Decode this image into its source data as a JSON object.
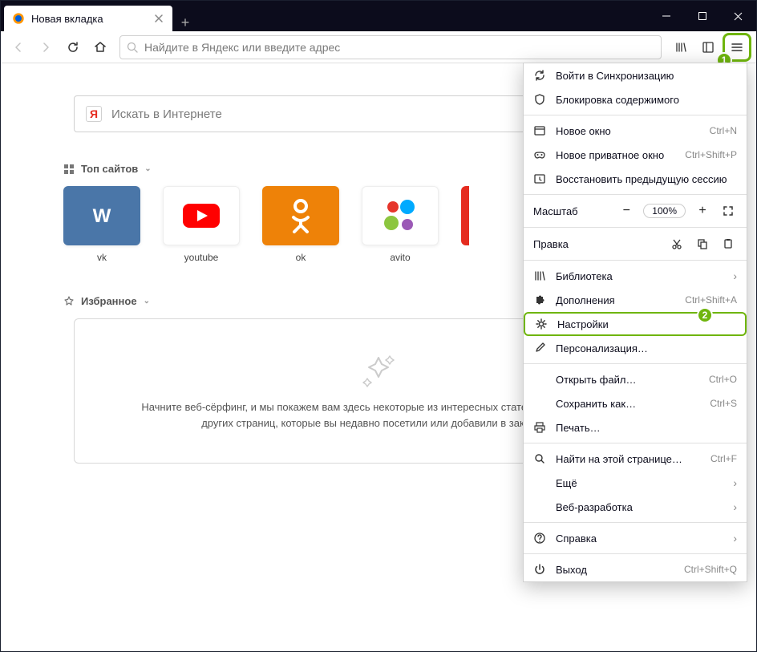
{
  "tab": {
    "title": "Новая вкладка"
  },
  "urlbar": {
    "placeholder": "Найдите в Яндекс или введите адрес"
  },
  "yandex": {
    "placeholder": "Искать в Интернете",
    "logo_letter": "Я"
  },
  "sections": {
    "top_sites": "Топ сайтов",
    "highlights": "Избранное"
  },
  "tiles": [
    {
      "id": "vk",
      "label": "vk"
    },
    {
      "id": "youtube",
      "label": "youtube"
    },
    {
      "id": "ok",
      "label": "ok"
    },
    {
      "id": "avito",
      "label": "avito"
    }
  ],
  "highlights_hint": "Начните веб-сёрфинг, и мы покажем вам здесь некоторые из интересных статей, видеороликов и других страниц, которые вы недавно посетили или добавили в закладки.",
  "callouts": {
    "one": "1",
    "two": "2"
  },
  "menu": {
    "sync": "Войти в Синхронизацию",
    "blocking": "Блокировка содержимого",
    "new_window": "Новое окно",
    "new_window_key": "Ctrl+N",
    "new_private": "Новое приватное окно",
    "new_private_key": "Ctrl+Shift+P",
    "restore": "Восстановить предыдущую сессию",
    "zoom_label": "Масштаб",
    "zoom_value": "100%",
    "edit_label": "Правка",
    "library": "Библиотека",
    "addons": "Дополнения",
    "addons_key": "Ctrl+Shift+A",
    "settings": "Настройки",
    "customize": "Персонализация…",
    "open_file": "Открыть файл…",
    "open_file_key": "Ctrl+O",
    "save_as": "Сохранить как…",
    "save_as_key": "Ctrl+S",
    "print": "Печать…",
    "find": "Найти на этой странице…",
    "find_key": "Ctrl+F",
    "more": "Ещё",
    "webdev": "Веб-разработка",
    "help": "Справка",
    "exit": "Выход",
    "exit_key": "Ctrl+Shift+Q"
  }
}
